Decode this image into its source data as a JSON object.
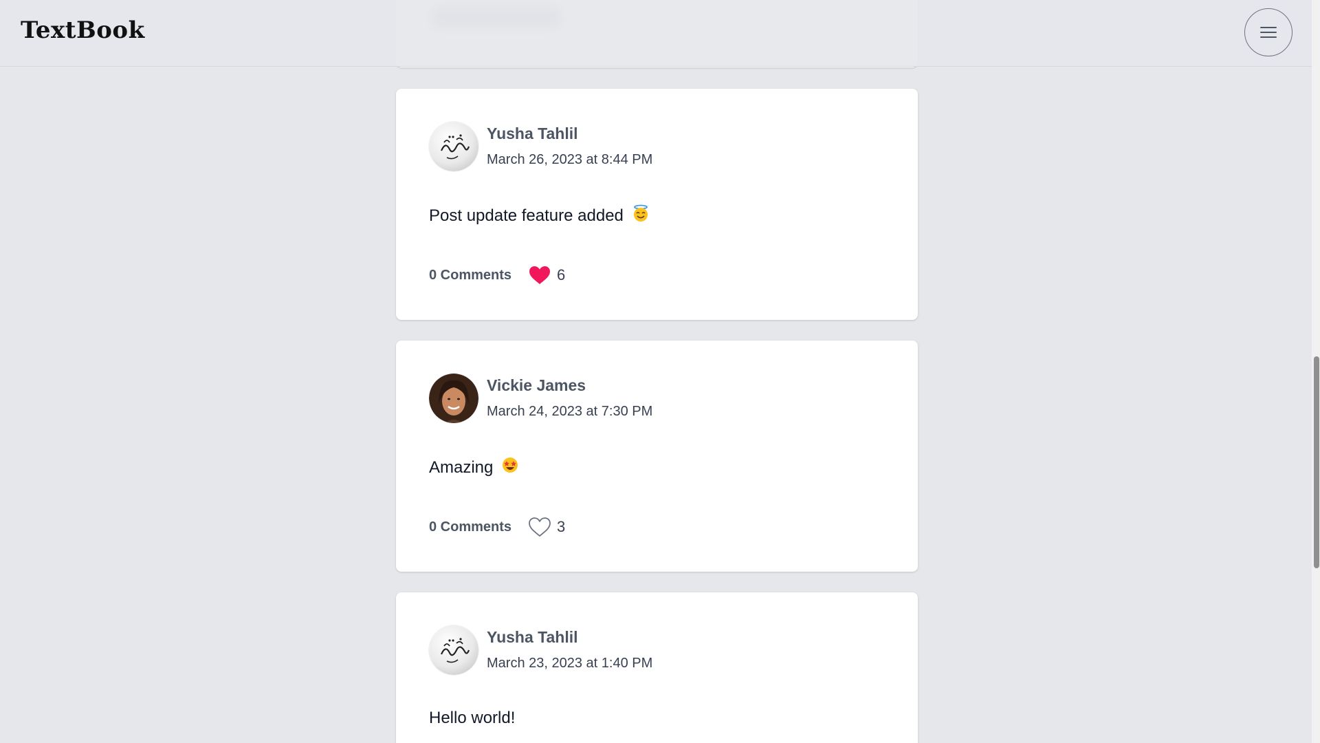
{
  "app": {
    "logo": "TextBook"
  },
  "posts": [
    {
      "author": "Yusha Tahlil",
      "avatar": "arabic-calligraphy-avatar",
      "date": "March 26, 2023 at 8:44 PM",
      "content": "Post update feature added",
      "emoji": "smiling-face-with-halo-emoji",
      "comments_label": "0 Comments",
      "likes": "6",
      "liked": true
    },
    {
      "author": "Vickie James",
      "avatar": "woman-portrait-avatar",
      "date": "March 24, 2023 at 7:30 PM",
      "content": "Amazing",
      "emoji": "star-struck-emoji",
      "comments_label": "0 Comments",
      "likes": "3",
      "liked": false
    },
    {
      "author": "Yusha Tahlil",
      "avatar": "arabic-calligraphy-avatar",
      "date": "March 23, 2023 at 1:40 PM",
      "content": "Hello world!"
    }
  ],
  "icons": {
    "menu": "hamburger-menu-icon",
    "like_filled": "heart-filled-icon",
    "like_empty": "heart-outline-icon"
  },
  "colors": {
    "background": "#e5e7eb",
    "card": "#ffffff",
    "heart": "#f0185b",
    "author": "#4b5563"
  }
}
